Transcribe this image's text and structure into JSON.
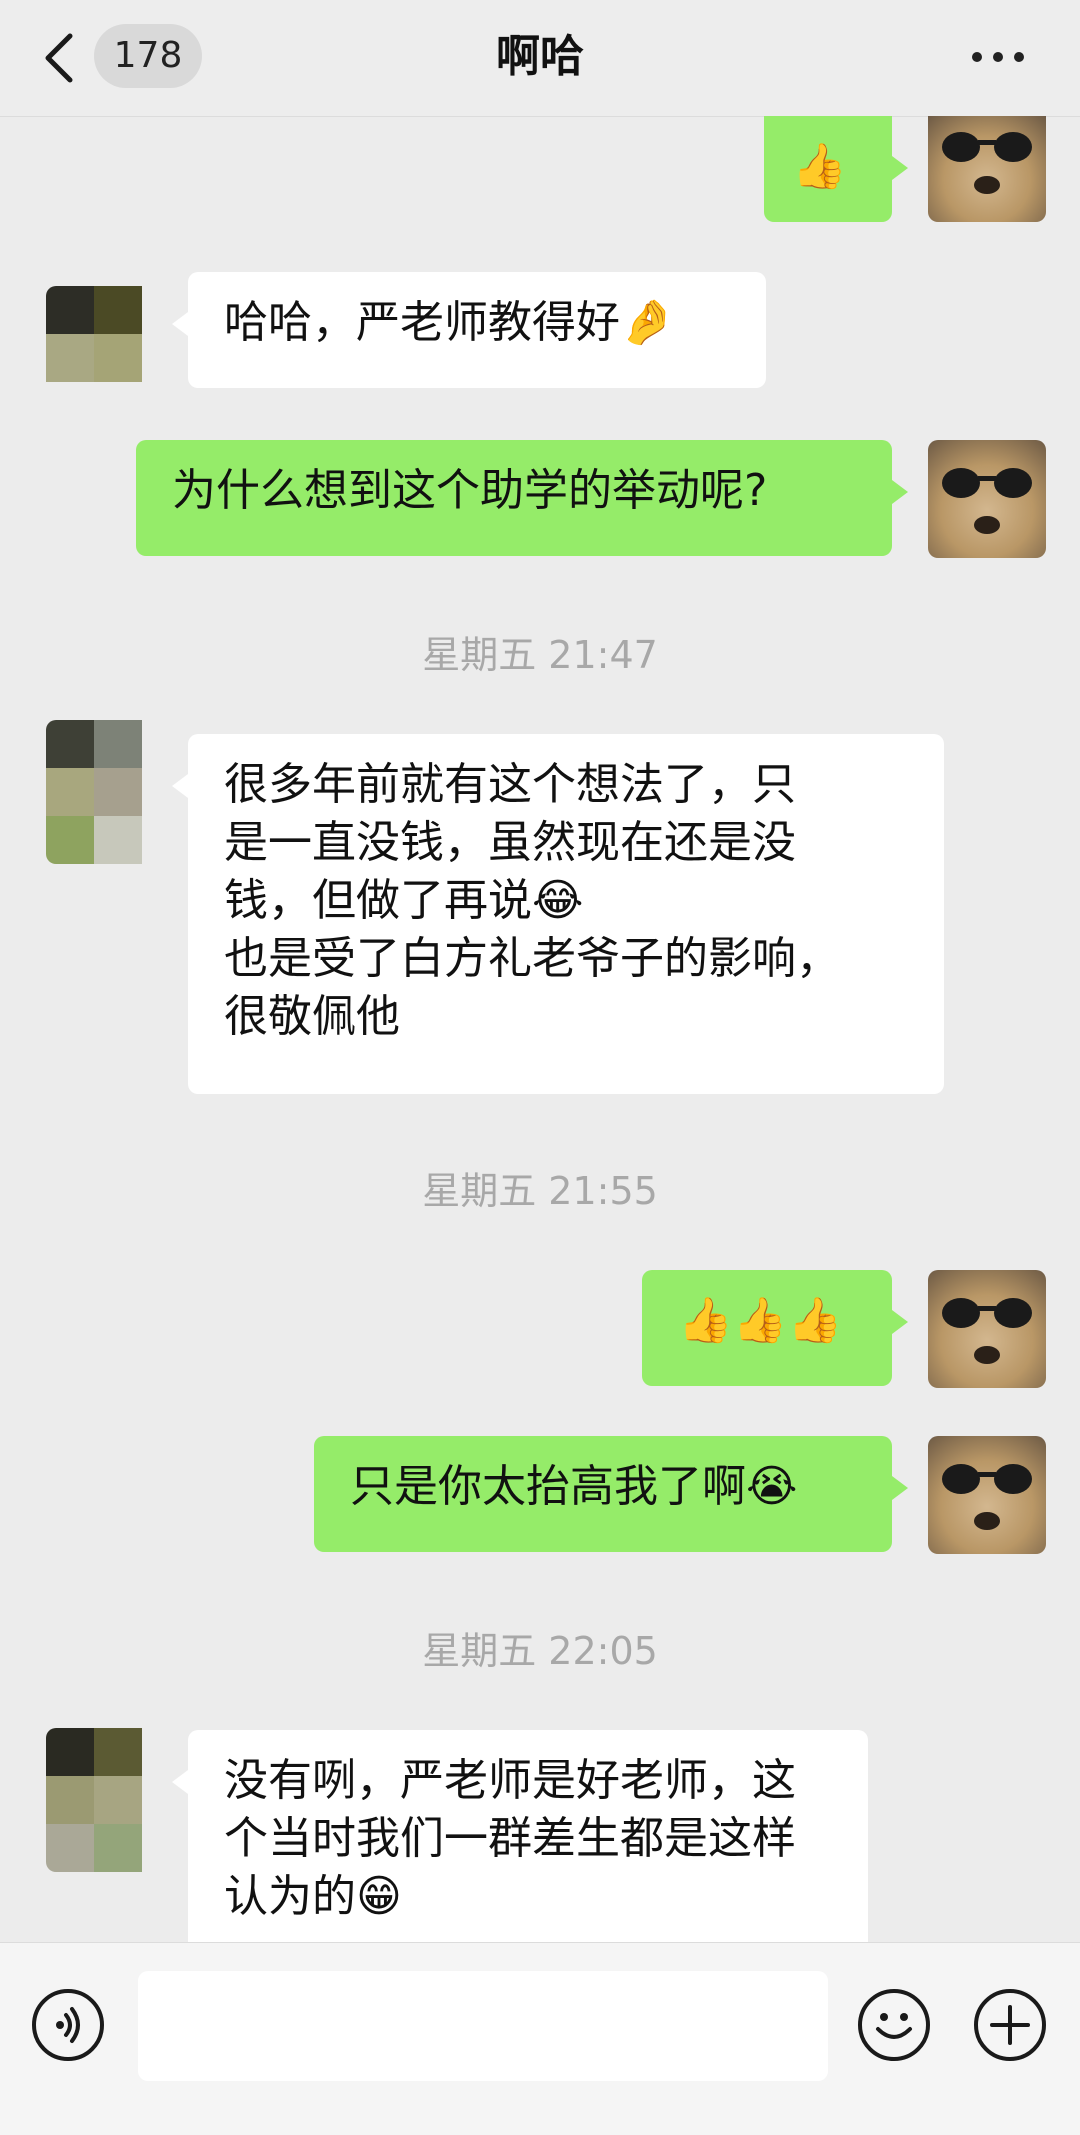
{
  "header": {
    "back_count": "178",
    "title": "啊哈"
  },
  "messages": {
    "m1": {
      "emoji": "👍"
    },
    "m2": {
      "text": "哈哈，严老师教得好",
      "emoji": "🤌"
    },
    "m3": {
      "text": "为什么想到这个助学的举动呢?"
    },
    "ts1": "星期五 21:47",
    "m4": {
      "line1": "很多年前就有这个想法了，只",
      "line2": "是一直没钱，虽然现在还是没",
      "line3": "钱，但做了再说",
      "emoji3": "😂",
      "line4": "也是受了白方礼老爷子的影响，",
      "line5": "很敬佩他"
    },
    "ts2": "星期五 21:55",
    "m5": {
      "emoji": "👍👍👍"
    },
    "m6": {
      "text": "只是你太抬高我了啊",
      "emoji": "😭"
    },
    "ts3": "星期五 22:05",
    "m7": {
      "line1": "没有咧，严老师是好老师，这",
      "line2": "个当时我们一群差生都是这样",
      "line3": "认为的",
      "emoji3": "😁"
    }
  },
  "colors": {
    "mine_bubble": "#95ec69",
    "their_bubble": "#ffffff",
    "background": "#ececec"
  },
  "icons": {
    "back": "chevron-left-icon",
    "more": "more-dots-icon",
    "voice": "voice-icon",
    "emoji": "emoji-icon",
    "plus": "plus-icon"
  }
}
